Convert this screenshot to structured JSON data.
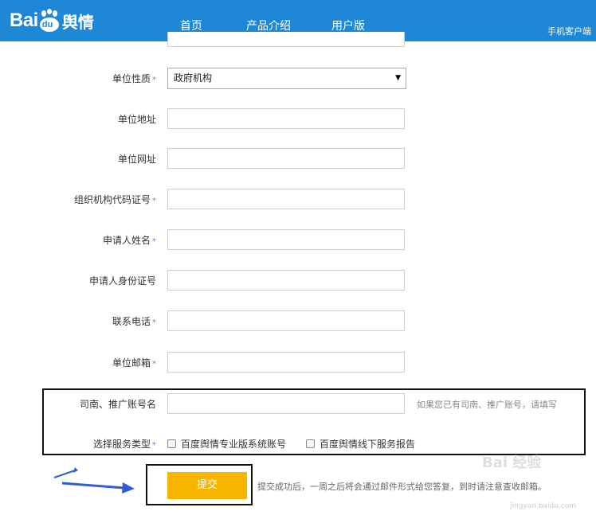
{
  "header": {
    "logo_text": "Bai",
    "logo_du": "du",
    "logo_suffix": "舆情",
    "nav": [
      "首页",
      "产品介绍",
      "用户版"
    ],
    "mobile_client": "手机客户端",
    "bg_color": "#1e88d6"
  },
  "form": {
    "unit_type": {
      "label": "单位性质",
      "required": "*",
      "value": "政府机构"
    },
    "unit_address": {
      "label": "单位地址",
      "value": ""
    },
    "unit_website": {
      "label": "单位网址",
      "value": ""
    },
    "org_code": {
      "label": "组织机构代码证号",
      "required": "*",
      "value": ""
    },
    "applicant_name": {
      "label": "申请人姓名",
      "required": "*",
      "value": ""
    },
    "applicant_id": {
      "label": "申请人身份证号",
      "value": ""
    },
    "phone": {
      "label": "联系电话",
      "required": "*",
      "value": ""
    },
    "email": {
      "label": "单位邮箱",
      "required": "*",
      "value": ""
    },
    "account_name": {
      "label": "司南、推广账号名",
      "value": "",
      "hint": "如果您已有司南、推广账号，请填写"
    },
    "service_type": {
      "label": "选择服务类型",
      "required": "*",
      "options": [
        "百度舆情专业版系统账号",
        "百度舆情线下服务报告"
      ]
    },
    "submit_label": "提交",
    "submit_note": "提交成功后，一周之后将会通过邮件形式给您答复，到时请注意查收邮箱。",
    "submit_color": "#f7b500"
  },
  "watermark": {
    "brand": "Bai 经验",
    "url": "jingyan.baidu.com"
  }
}
